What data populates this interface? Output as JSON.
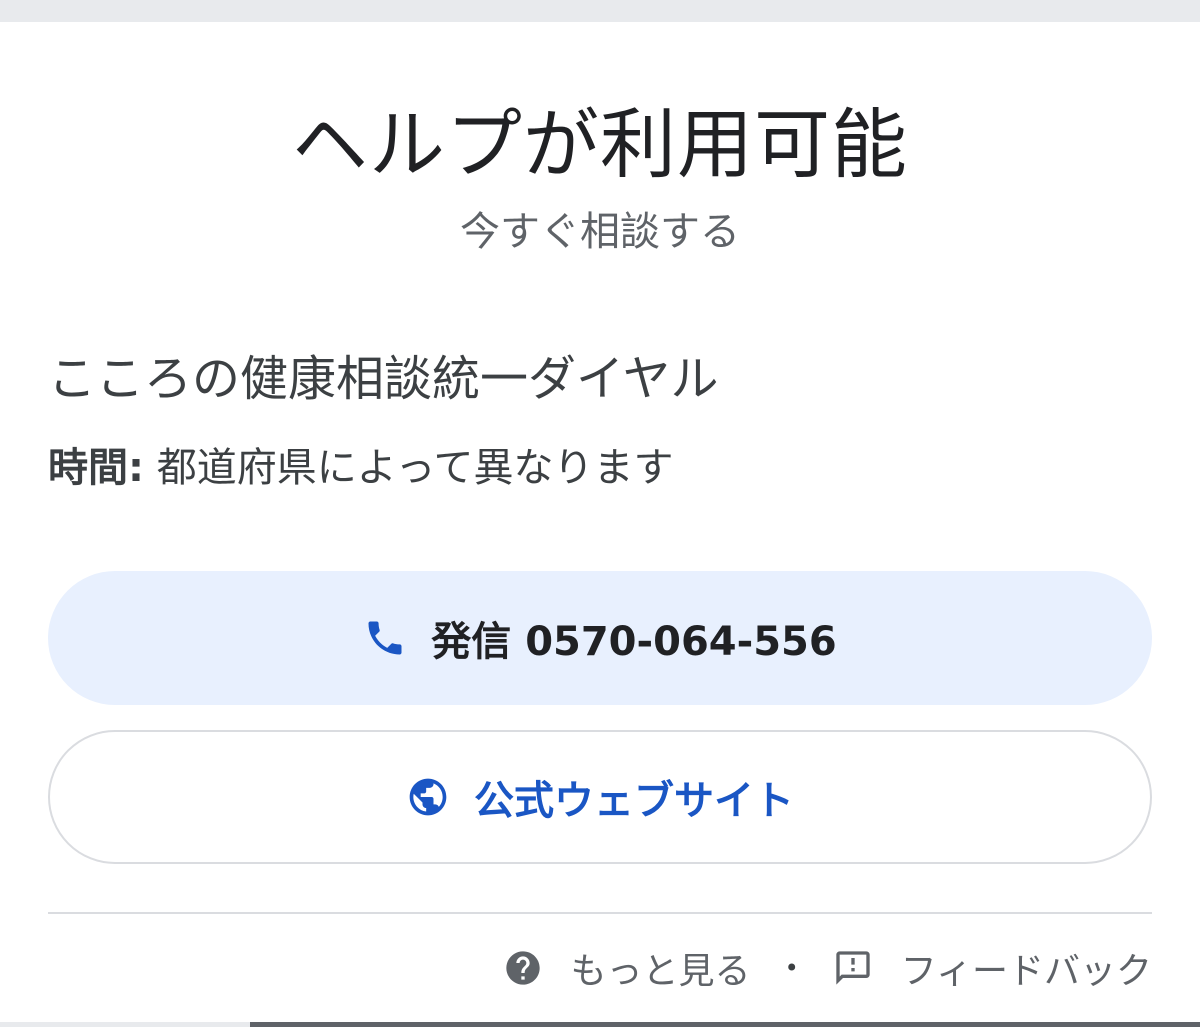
{
  "panel": {
    "title": "ヘルプが利用可能",
    "subtitle": "今すぐ相談する"
  },
  "service": {
    "name": "こころの健康相談統一ダイヤル",
    "hours_label": "時間:",
    "hours_value": " 都道府県によって異なります"
  },
  "actions": {
    "call_label": "発信 0570-064-556",
    "website_label": "公式ウェブサイト"
  },
  "footer": {
    "more_label": "もっと見る",
    "separator": "•",
    "feedback_label": "フィードバック"
  },
  "icons": {
    "call": "phone-icon",
    "website": "globe-icon",
    "more": "help-circle-icon",
    "feedback": "feedback-icon"
  },
  "colors": {
    "call_button_bg": "#e8f0fe",
    "accent_blue": "#1a56c4",
    "text_primary": "#202124",
    "text_secondary": "#5f6368"
  }
}
